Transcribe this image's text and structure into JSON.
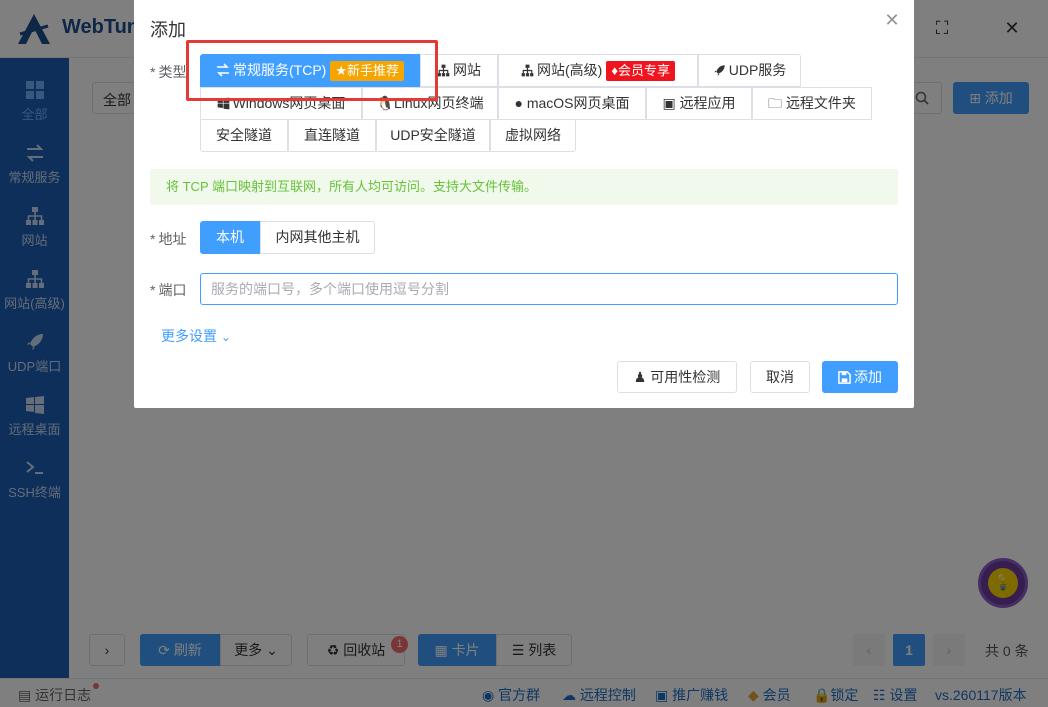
{
  "app": {
    "title": "WebTun"
  },
  "sidebar": {
    "items": [
      {
        "label": "全部",
        "icon": "grid-icon"
      },
      {
        "label": "常规服务",
        "icon": "swap-icon"
      },
      {
        "label": "网站",
        "icon": "sitemap-icon"
      },
      {
        "label": "网站(高级)",
        "icon": "sitemap-icon"
      },
      {
        "label": "UDP端口",
        "icon": "rocket-icon"
      },
      {
        "label": "远程桌面",
        "icon": "windows-icon"
      },
      {
        "label": "SSH终端",
        "icon": "terminal-icon"
      }
    ]
  },
  "toolbar": {
    "filter_value": "全部",
    "add_label": "添加"
  },
  "bottom": {
    "refresh_label": "刷新",
    "more_label": "更多",
    "recycle_label": "回收站",
    "recycle_badge": "1",
    "card_label": "卡片",
    "list_label": "列表",
    "page": "1",
    "total": "共 0 条"
  },
  "statusbar": {
    "log_label": "运行日志",
    "links": [
      "官方群",
      "远程控制",
      "推广赚钱",
      "会员",
      "锁定",
      "设置",
      "vs.260117版本"
    ]
  },
  "dialog": {
    "title": "添加",
    "type_label": "类型",
    "types": {
      "tcp": "常规服务(TCP)",
      "tcp_tag": "新手推荐",
      "site": "网站",
      "site_adv": "网站(高级)",
      "vip_tag": "会员专享",
      "udp": "UDP服务",
      "windows": "Windows网页桌面",
      "linux": "Linux网页终端",
      "macos": "macOS网页桌面",
      "remote_app": "远程应用",
      "remote_folder": "远程文件夹",
      "secure_tunnel": "安全隧道",
      "direct_tunnel": "直连隧道",
      "udp_secure": "UDP安全隧道",
      "vnet": "虚拟网络"
    },
    "info": "将 TCP 端口映射到互联网，所有人均可访问。支持大文件传输。",
    "address_label": "地址",
    "address_options": [
      "本机",
      "内网其他主机"
    ],
    "port_label": "端口",
    "port_placeholder": "服务的端口号，多个端口使用逗号分割",
    "more_settings": "更多设置",
    "check_label": "可用性检测",
    "cancel_label": "取消",
    "submit_label": "添加"
  },
  "colors": {
    "primary": "#409eff",
    "sidebar": "#1a5fb4",
    "highlight": "#e53935",
    "tag_yellow": "#f6a400",
    "tag_red": "#f0141e",
    "alert_bg": "#f0f9eb",
    "alert_text": "#67c23a"
  }
}
